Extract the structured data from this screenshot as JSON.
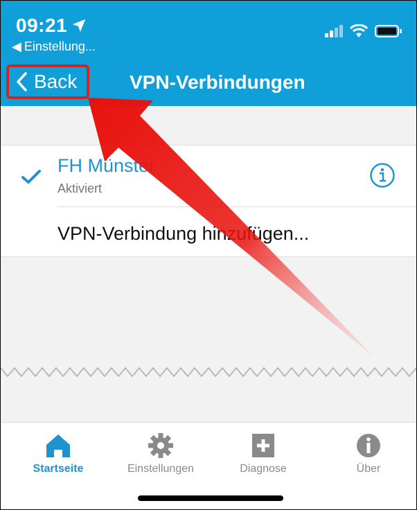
{
  "status_bar": {
    "time": "09:21",
    "previous_app": "Einstellung..."
  },
  "nav": {
    "back_label": "Back",
    "title": "VPN-Verbindungen"
  },
  "vpn_list": {
    "items": [
      {
        "name": "FH Münster",
        "status": "Aktiviert",
        "selected": true
      }
    ],
    "add_label": "VPN-Verbindung hinzufügen..."
  },
  "tabbar": {
    "tabs": [
      {
        "label": "Startseite",
        "icon": "home-icon",
        "active": true
      },
      {
        "label": "Einstellungen",
        "icon": "gear-icon",
        "active": false
      },
      {
        "label": "Diagnose",
        "icon": "plus-square-icon",
        "active": false
      },
      {
        "label": "Über",
        "icon": "info-icon",
        "active": false
      }
    ]
  },
  "colors": {
    "accent": "#119fd9",
    "link": "#1f93cf",
    "highlight": "#e0201b",
    "inactive": "#8a8a8a"
  }
}
